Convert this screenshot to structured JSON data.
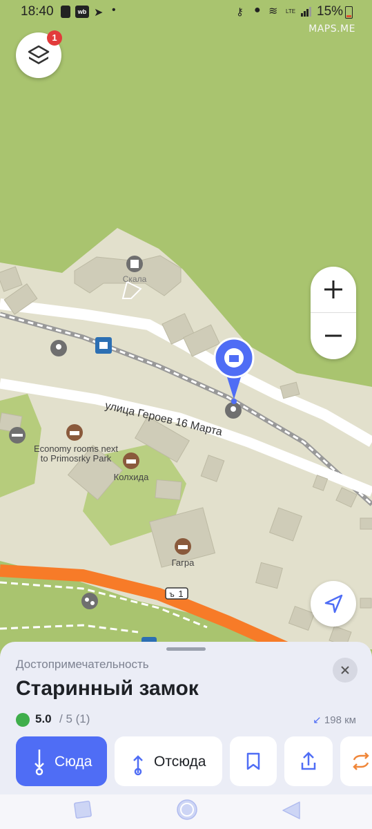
{
  "status_bar": {
    "time": "18:40",
    "battery": "15%",
    "network_label": "LTE"
  },
  "watermark": "MAPS.ME",
  "layers": {
    "badge_count": "1"
  },
  "map": {
    "poi_castle": "Скала",
    "street": "улица Героев 16 Марта",
    "poi_economy_line1": "Economy rooms next",
    "poi_economy_line2": "to Primosrky Park",
    "poi_kolkhida": "Колхида",
    "poi_gagra": "Гагра",
    "road_shield": "1"
  },
  "place": {
    "category": "Достопримечательность",
    "title": "Старинный замок",
    "rating_value": "5.0",
    "rating_max": "/ 5",
    "rating_count": "(1)",
    "distance": "198 км"
  },
  "actions": {
    "to_here": "Сюда",
    "from_here": "Отсюда"
  },
  "colors": {
    "accent": "#4f6df5",
    "map_green": "#a9c46f",
    "map_built": "#e2e0cc",
    "route_orange": "#f77b28",
    "share_orange": "#f0873a"
  }
}
